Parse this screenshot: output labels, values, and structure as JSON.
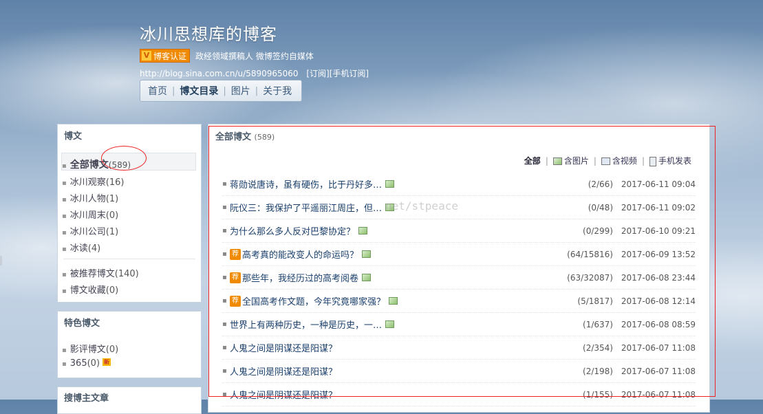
{
  "header": {
    "title": "冰川思想库的博客",
    "badge_label": "博客认证",
    "badge_icon": "V",
    "cert_text": "政经领域撰稿人 微博签约自媒体",
    "url": "http://blog.sina.com.cn/u/5890965060",
    "subscribe": "[订阅]",
    "mobile_subscribe": "[手机订阅]"
  },
  "nav": [
    {
      "label": "首页",
      "active": false
    },
    {
      "label": "博文目录",
      "active": true
    },
    {
      "label": "图片",
      "active": false
    },
    {
      "label": "关于我",
      "active": false
    }
  ],
  "sidebar": {
    "posts_title": "博文",
    "categories": [
      {
        "label": "全部博文",
        "count": "(589)"
      },
      {
        "label": "冰川观察",
        "count": "(16)"
      },
      {
        "label": "冰川人物",
        "count": "(1)"
      },
      {
        "label": "冰川周末",
        "count": "(0)"
      },
      {
        "label": "冰川公司",
        "count": "(1)"
      },
      {
        "label": "冰读",
        "count": "(4)"
      }
    ],
    "extras": [
      {
        "label": "被推荐博文",
        "count": "(140)"
      },
      {
        "label": "博文收藏",
        "count": "(0)"
      }
    ],
    "featured_title": "特色博文",
    "featured": [
      {
        "label": "影评博文",
        "count": "(0)"
      },
      {
        "label": "365",
        "count": "(0)",
        "new_badge": "新"
      }
    ],
    "bottom_title": "搜博主文章"
  },
  "main": {
    "title": "全部博文",
    "count": "(589)",
    "filters": {
      "all": "全部",
      "with_images": "含图片",
      "with_video": "含视频",
      "mobile": "手机发表"
    },
    "rec_badge": "荐",
    "articles": [
      {
        "title": "蒋勋说唐诗，虽有硬伤，比于丹好多…",
        "img": true,
        "rec": false,
        "stats": "(2/66)",
        "time": "2017-06-11 09:04"
      },
      {
        "title": "阮仪三：我保护了平遥丽江周庄，但…",
        "img": true,
        "rec": false,
        "stats": "(0/48)",
        "time": "2017-06-11 09:02"
      },
      {
        "title": "为什么那么多人反对巴黎协定？",
        "img": true,
        "rec": false,
        "stats": "(0/299)",
        "time": "2017-06-10 09:21"
      },
      {
        "title": "高考真的能改变人的命运吗？",
        "img": true,
        "rec": true,
        "stats": "(64/15816)",
        "time": "2017-06-09 13:52"
      },
      {
        "title": "那些年，我经历过的高考阅卷",
        "img": true,
        "rec": true,
        "stats": "(63/32087)",
        "time": "2017-06-08 23:44"
      },
      {
        "title": "全国高考作文题，今年究竟哪家强？",
        "img": true,
        "rec": true,
        "stats": "(5/1817)",
        "time": "2017-06-08 12:14"
      },
      {
        "title": "世界上有两种历史，一种是历史，一…",
        "img": true,
        "rec": false,
        "stats": "(1/637)",
        "time": "2017-06-08 08:59"
      },
      {
        "title": "人鬼之间是阴谋还是阳谋？",
        "img": false,
        "rec": false,
        "stats": "(2/354)",
        "time": "2017-06-07 11:08"
      },
      {
        "title": "人鬼之间是阴谋还是阳谋？",
        "img": false,
        "rec": false,
        "stats": "(2/198)",
        "time": "2017-06-07 11:08"
      },
      {
        "title": "人鬼之间是阴谋还是阳谋？",
        "img": false,
        "rec": false,
        "stats": "(1/155)",
        "time": "2017-06-07 11:08"
      }
    ]
  },
  "watermark": "net/stpeace",
  "colors": {
    "accent_orange": "#f08a00",
    "link_blue": "#1a3f6c",
    "annotation_red": "#e22222"
  }
}
